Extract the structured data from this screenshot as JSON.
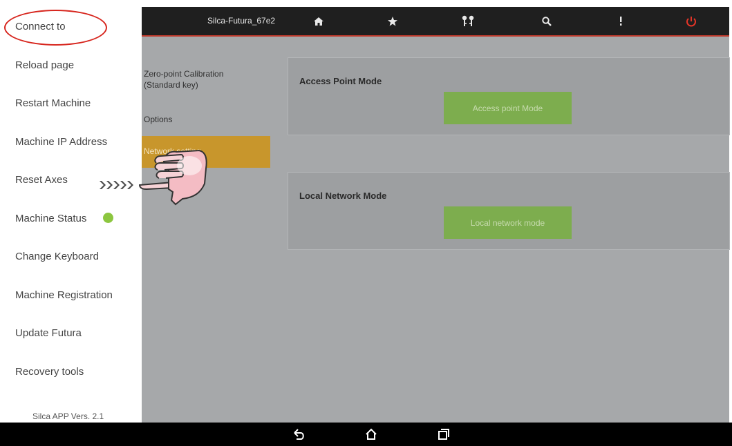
{
  "topbar": {
    "device_name": "Silca-Futura_67e2",
    "icons": [
      "home-icon",
      "star-icon",
      "keys-icon",
      "search-icon",
      "more-vert-icon",
      "power-icon"
    ],
    "accent_color": "#c0392b"
  },
  "submenu": {
    "items": [
      {
        "label": "Zero-point Calibration\n(Standard key)"
      },
      {
        "label": "Options"
      },
      {
        "label": "Network setting"
      }
    ],
    "active_color": "#c8962c"
  },
  "panels": {
    "access_point": {
      "title": "Access Point Mode",
      "button": "Access point Mode"
    },
    "local_network": {
      "title": "Local Network Mode",
      "button": "Local network mode"
    },
    "button_color": "#7dad4e"
  },
  "drawer": {
    "items": [
      {
        "label": "Connect to"
      },
      {
        "label": "Reload page"
      },
      {
        "label": "Restart Machine"
      },
      {
        "label": "Machine IP Address"
      },
      {
        "label": "Reset Axes"
      },
      {
        "label": "Machine Status"
      },
      {
        "label": "Change Keyboard"
      },
      {
        "label": "Machine Registration"
      },
      {
        "label": "Update Futura"
      },
      {
        "label": "Recovery tools"
      }
    ],
    "status_color": "#8cc63f",
    "version": "Silca APP Vers. 2.1"
  },
  "navbar": {
    "icons": [
      "back-icon",
      "home-nav-icon",
      "recents-icon"
    ]
  }
}
